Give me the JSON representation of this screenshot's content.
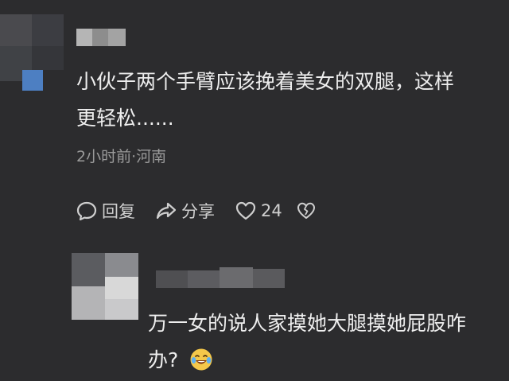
{
  "comments": [
    {
      "text_line1": "小伙子两个手臂应该挽着美女的双腿，这样",
      "text_line2": "更轻松......",
      "meta": "2小时前·河南",
      "actions": {
        "reply_label": "回复",
        "share_label": "分享",
        "like_count": "24"
      }
    },
    {
      "text_line1": "万一女的说人家摸她大腿摸她屁股咋",
      "text_line2": "办?",
      "emoji": "crying-laughing-emoji"
    }
  ],
  "icons": {
    "reply": "reply-bubble-icon",
    "share": "share-arrow-icon",
    "like": "heart-icon",
    "dislike": "broken-heart-icon"
  },
  "colors": {
    "background": "#2c2c2e",
    "text": "#eeeeee",
    "meta": "#9a9a9a",
    "emoji": "#f5c84a"
  }
}
